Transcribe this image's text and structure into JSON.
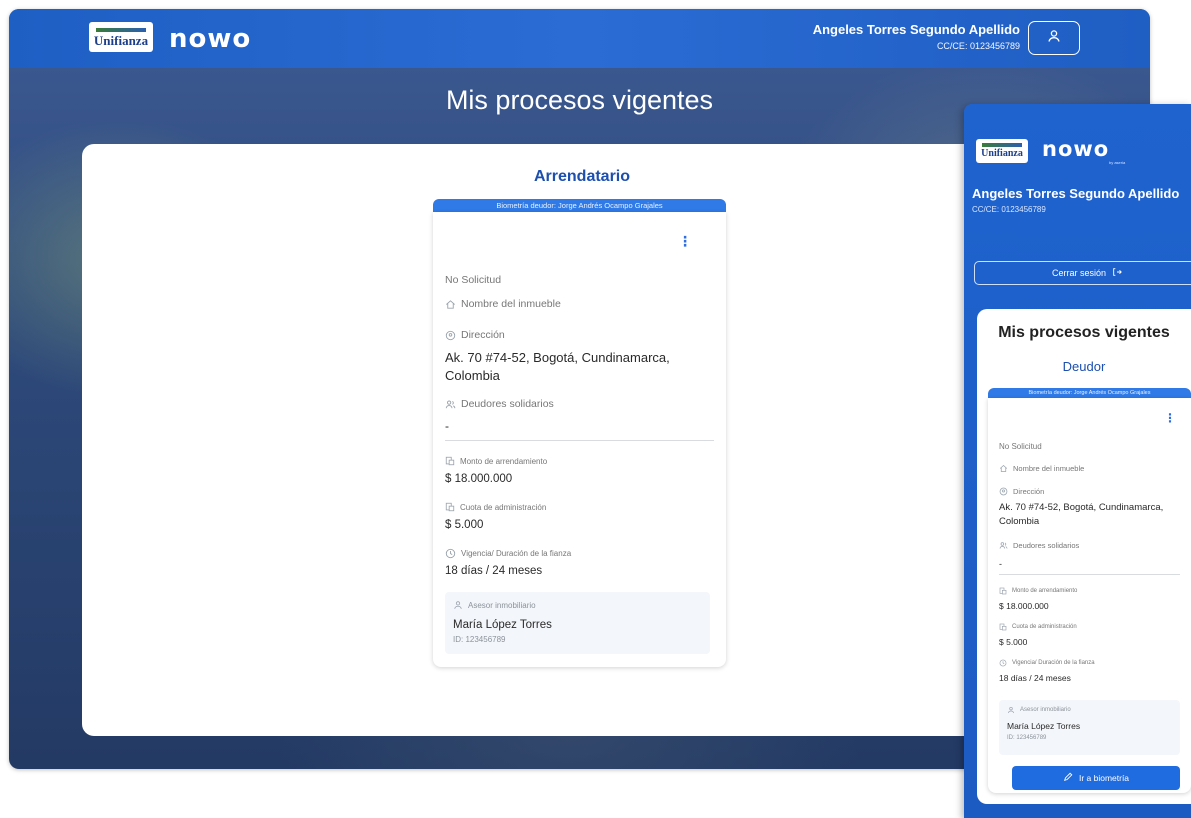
{
  "brand": {
    "badge": "Unifianza",
    "product": "nowo",
    "product_sub": "by aseria"
  },
  "user": {
    "name": "Angeles Torres Segundo Apellido",
    "id": "CC/CE: 0123456789"
  },
  "desktop": {
    "page_title": "Mis procesos vigentes",
    "role": "Arrendatario",
    "card": {
      "banner": "Biometría deudor: Jorge Andrés Ocampo Grajales",
      "no_solicitud": "No Solicitud",
      "property_label": "Nombre del inmueble",
      "address_label": "Dirección",
      "address_value": "Ak. 70 #74-52, Bogotá, Cundinamarca, Colombia",
      "codebtors_label": "Deudores solidarios",
      "codebtors_value": "-",
      "rent_label": "Monto de arrendamiento",
      "rent_value": "$ 18.000.000",
      "admin_label": "Cuota de administración",
      "admin_value": "$ 5.000",
      "validity_label": "Vigencia/ Duración de la fianza",
      "validity_value": "18 días / 24 meses",
      "advisor_label": "Asesor inmobiliario",
      "advisor_name": "María López Torres",
      "advisor_id": "ID: 123456789"
    }
  },
  "mobile": {
    "logout": "Cerrar sesión",
    "page_title": "Mis procesos vigentes",
    "role": "Deudor",
    "card": {
      "banner": "Biometría deudor: Jorge Andrés Ocampo Grajales",
      "no_solicitud": "No Solicitud",
      "property_label": "Nombre del inmueble",
      "address_label": "Dirección",
      "address_value": "Ak. 70 #74-52, Bogotá, Cundinamarca, Colombia",
      "codebtors_label": "Deudores solidarios",
      "codebtors_value": "-",
      "rent_label": "Monto de arrendamiento",
      "rent_value": "$ 18.000.000",
      "admin_label": "Cuota de administración",
      "admin_value": "$ 5.000",
      "validity_label": "Vigencia/ Duración de la fianza",
      "validity_value": "18 días / 24 meses",
      "advisor_label": "Asesor inmobiliario",
      "advisor_name": "María López Torres",
      "advisor_id": "ID: 123456789",
      "biometry_button": "Ir a biometría"
    }
  },
  "icons": [
    "home-icon",
    "location-pin-icon",
    "users-icon",
    "money-icon",
    "clock-icon",
    "user-icon",
    "edit-icon",
    "logout-icon",
    "kebab-menu-icon"
  ],
  "colors": {
    "primary": "#1f63cf",
    "accent": "#2f7ae6",
    "role_text": "#1d4fae"
  }
}
